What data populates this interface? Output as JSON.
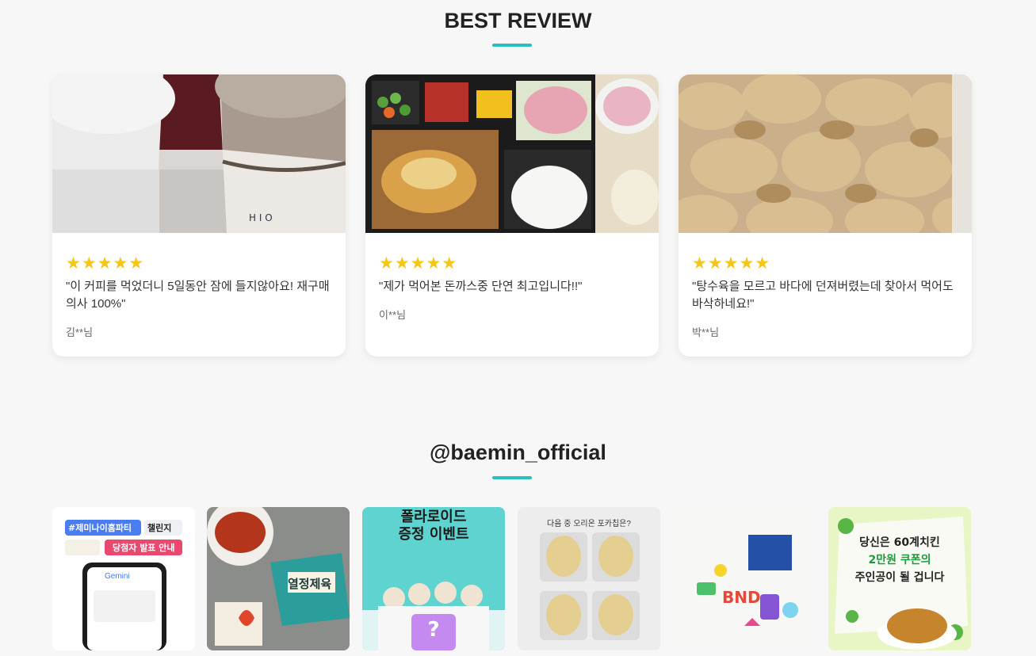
{
  "best_review": {
    "title": "BEST REVIEW",
    "reviews": [
      {
        "stars": "★★★★★",
        "rating": 5,
        "text": "\"이 커피를 먹었더니 5일동안 잠에 들지않아요! 재구매 의사 100%\"",
        "author": "김**님",
        "photo_icon": "coffee-cups-photo"
      },
      {
        "stars": "★★★★★",
        "rating": 5,
        "text": "\"제가 먹어본 돈까스중 단연 최고입니다!!\"",
        "author": "이**님",
        "photo_icon": "tonkatsu-lunchbox-photo"
      },
      {
        "stars": "★★★★★",
        "rating": 5,
        "text": "\"탕수육을 모르고 바다에 던져버렸는데 찾아서 먹어도 바삭하네요!\"",
        "author": "박**님",
        "photo_icon": "fried-pork-photo"
      }
    ]
  },
  "instagram": {
    "title": "@baemin_official",
    "posts": [
      {
        "icon": "gemini-challenge-post",
        "lines": [
          "#제미나이홈파티",
          "챌린지",
          "당첨자 발표 안내",
          "Gemini"
        ]
      },
      {
        "icon": "spicy-pork-post",
        "lines": [
          "열정제육"
        ]
      },
      {
        "icon": "polaroid-event-post",
        "lines": [
          "폴라로이드",
          "증정 이벤트",
          "?"
        ]
      },
      {
        "icon": "potato-chip-quiz-post",
        "lines": [
          "다음 중 오리온 포카칩은?"
        ]
      },
      {
        "icon": "bnd-magnets-post",
        "lines": [
          "BND"
        ]
      },
      {
        "icon": "chicken-coupon-post",
        "lines": [
          "당신은 60계치킨",
          "2만원 쿠폰의",
          "주인공이 될 겁니다"
        ]
      }
    ]
  },
  "colors": {
    "accent": "#2ac1bc",
    "star": "#f5c518",
    "background": "#f7f7f7"
  }
}
